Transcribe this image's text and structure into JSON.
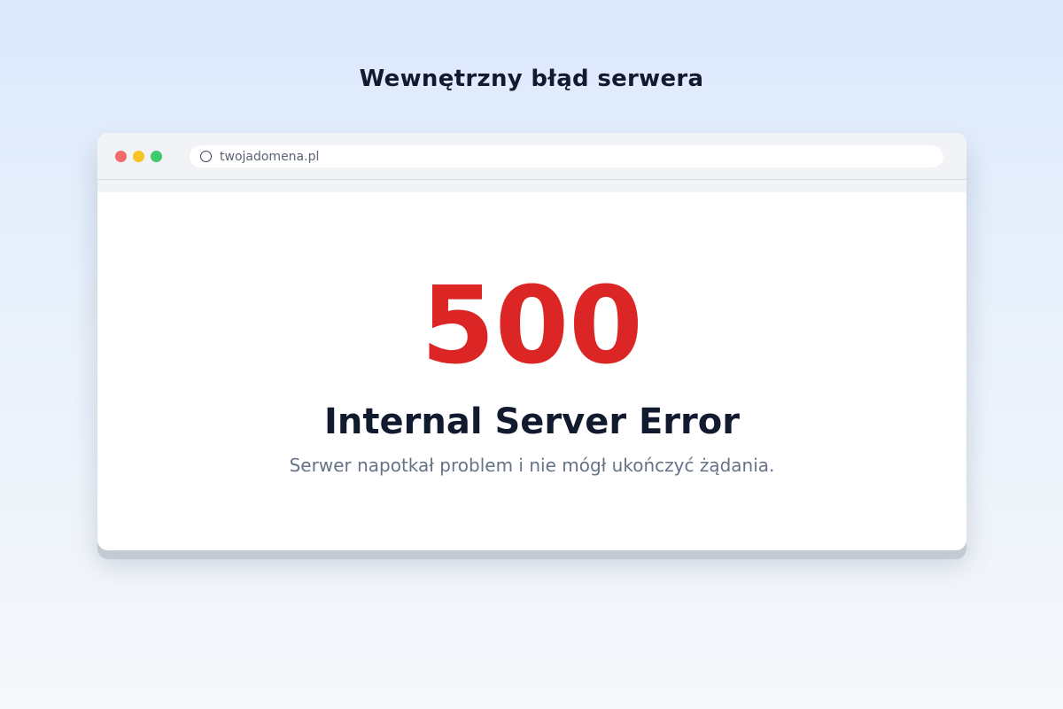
{
  "page": {
    "heading": "Wewnętrzny błąd serwera"
  },
  "browser": {
    "window_controls": [
      {
        "name": "close",
        "color": "#f26b6b"
      },
      {
        "name": "minimize",
        "color": "#f8c320"
      },
      {
        "name": "maximize",
        "color": "#3ecb6c"
      }
    ],
    "address_bar": {
      "icon": "globe-icon",
      "url": "twojadomena.pl"
    }
  },
  "error": {
    "code": "500",
    "title": "Internal Server Error",
    "message": "Serwer napotkał problem i nie mógł ukończyć żądania.",
    "accent_color": "#dc2626"
  }
}
